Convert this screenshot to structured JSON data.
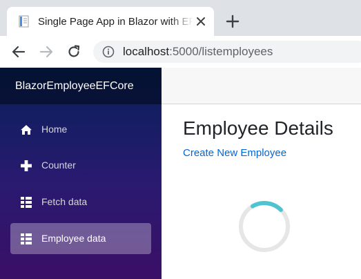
{
  "browser": {
    "tab_title": "Single Page App in Blazor with EF Core",
    "favicon": "document-icon",
    "url_host": "localhost",
    "url_rest": ":5000/listemployees",
    "colors": {
      "tabstrip": "#dee1e6",
      "omnibox": "#f1f3f4"
    }
  },
  "app": {
    "brand": "BlazorEmployeeEFCore",
    "nav": [
      {
        "label": "Home",
        "icon": "home-icon",
        "active": false
      },
      {
        "label": "Counter",
        "icon": "plus-icon",
        "active": false
      },
      {
        "label": "Fetch data",
        "icon": "list-icon",
        "active": false
      },
      {
        "label": "Employee data",
        "icon": "list-icon",
        "active": true
      }
    ],
    "colors": {
      "sidebar_top": "#062058",
      "sidebar_bottom": "#3a0f66",
      "link": "#0366d6",
      "spinner": "#4fc4d0"
    }
  },
  "main": {
    "title": "Employee Details",
    "create_link": "Create New Employee",
    "loading_icon": "spinner-icon"
  }
}
